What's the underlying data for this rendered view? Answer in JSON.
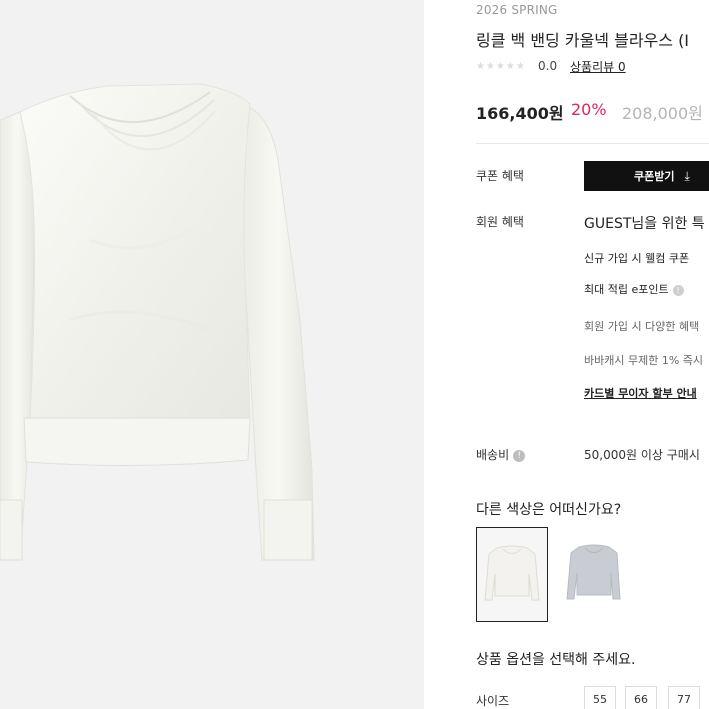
{
  "product": {
    "season": "2026 SPRING",
    "title": "링클 백 밴딩 카울넥 블라우스 (I",
    "stars": "★★★★★",
    "rating": "0.0",
    "review_link": "상품리뷰 0",
    "price": "166,400원",
    "discount": "20%",
    "original_price": "208,000원"
  },
  "coupon": {
    "label": "쿠폰 혜택",
    "button_label": "쿠폰받기",
    "button_icon": "download-icon"
  },
  "member": {
    "label": "회원 혜택",
    "headline": "GUEST님을 위한 특",
    "benefits": [
      "신규 가입 시 웰컴 쿠폰 ",
      "최대 적립 e포인트",
      "회원 가입 시 다양한 혜택",
      "바바캐시 무제한 1% 즉시",
      "카드별 무이자 할부 안내"
    ]
  },
  "shipping": {
    "label": "배송비",
    "text": "50,000원 이상 구매시 "
  },
  "colors": {
    "question": "다른 색상은 어떠신가요?",
    "swatches": [
      {
        "name": "ivory",
        "color": "#f3f2ee",
        "selected": true
      },
      {
        "name": "gray",
        "color": "#c9ccd2",
        "selected": false
      }
    ]
  },
  "options": {
    "question": "상품 옵션을 선택해 주세요.",
    "size_label": "사이즈",
    "sizes": [
      "55",
      "66",
      "77"
    ]
  },
  "theme": {
    "accent": "#e0245e",
    "button_bg": "#111111",
    "image_bg": "#f2f2f2"
  }
}
